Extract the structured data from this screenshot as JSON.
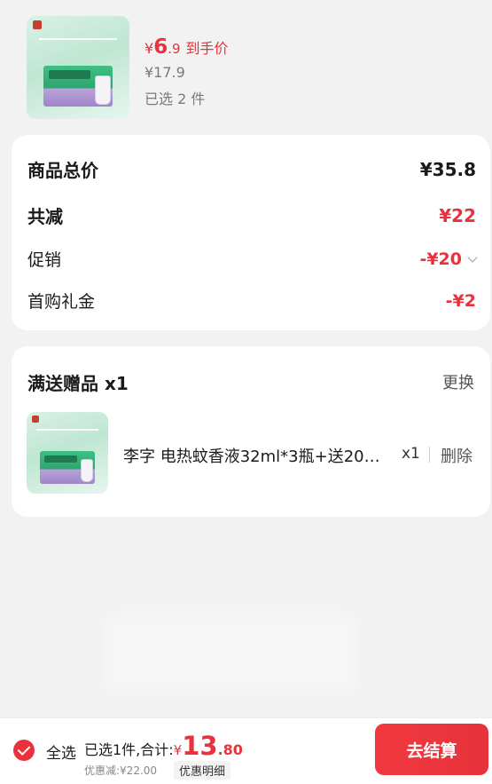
{
  "top_product": {
    "price_yen": "¥",
    "price_int": "6",
    "price_dec": ".9",
    "price_tag": "到手价",
    "original_price": "¥17.9",
    "selected": "已选 2 件"
  },
  "summary": {
    "total_label": "商品总价",
    "total_value": "¥35.8",
    "reduce_label": "共减",
    "reduce_value": "¥22",
    "promo_label": "促销",
    "promo_value": "-¥20",
    "first_buy_label": "首购礼金",
    "first_buy_value": "-¥2"
  },
  "gift": {
    "title": "满送赠品 x1",
    "change": "更换",
    "name": "李字 电热蚊香液32ml*3瓶+送20…",
    "qty": "x1",
    "delete": "删除"
  },
  "bottom": {
    "select_all": "全选",
    "total_label": "已选1件,合计:",
    "total_yen": "¥",
    "total_int": "13",
    "total_dec": ".80",
    "discount": "优惠减:¥22.00",
    "detail": "优惠明细",
    "checkout": "去结算"
  },
  "colors": {
    "accent": "#e8323c",
    "background": "#f2f2f2"
  }
}
